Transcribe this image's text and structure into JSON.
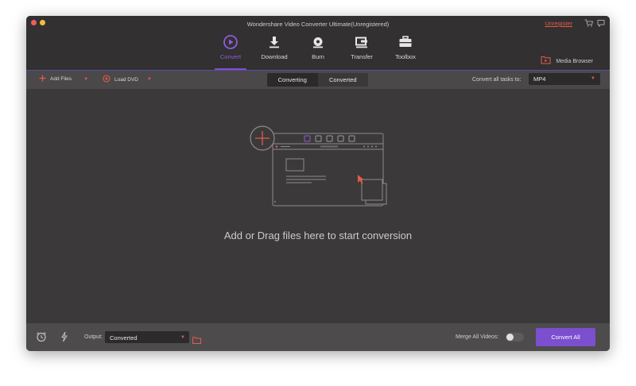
{
  "window": {
    "title": "Wondershare Video Converter Ultimate(Unregistered)",
    "unregister_link": "Unregister"
  },
  "nav": {
    "tabs": [
      {
        "label": "Convert",
        "icon": "convert-icon",
        "active": true
      },
      {
        "label": "Download",
        "icon": "download-icon"
      },
      {
        "label": "Burn",
        "icon": "burn-disc-icon"
      },
      {
        "label": "Transfer",
        "icon": "transfer-icon"
      },
      {
        "label": "Toolbox",
        "icon": "toolbox-icon"
      }
    ],
    "media_browser": "Media Browser"
  },
  "toolbar": {
    "add_files": "Add Files",
    "load_dvd": "Load DVD",
    "tabs": [
      "Converting",
      "Converted"
    ],
    "convert_all_label": "Convert all tasks to:",
    "format": "MP4"
  },
  "content": {
    "drop_text": "Add or Drag files here to start conversion"
  },
  "bottom": {
    "output_label": "Output:",
    "output_value": "Converted",
    "merge_label": "Merge All Videos:",
    "convert_all_button": "Convert All"
  },
  "colors": {
    "accent": "#7b4fce",
    "link": "#e65a4a",
    "background": "#3b393a"
  }
}
